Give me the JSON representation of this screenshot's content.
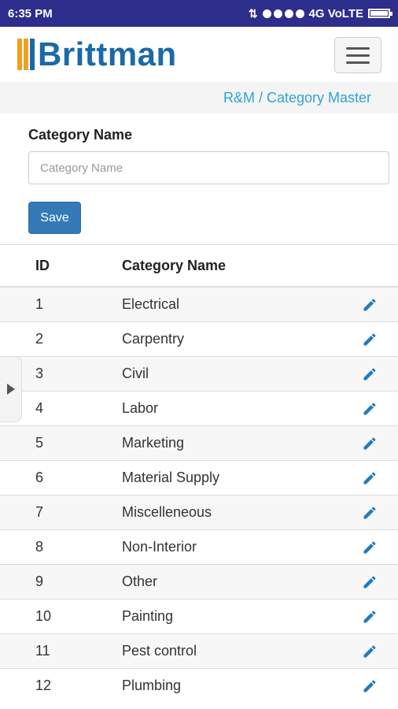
{
  "status_bar": {
    "time": "6:35 PM",
    "network": "4G VoLTE"
  },
  "header": {
    "logo_text": "Brittman"
  },
  "breadcrumb": {
    "text": "R&M / Category Master"
  },
  "form": {
    "label": "Category Name",
    "input_value": "",
    "input_placeholder": "Category Name",
    "save_label": "Save"
  },
  "table": {
    "headers": {
      "id": "ID",
      "name": "Category Name"
    },
    "rows": [
      {
        "id": "1",
        "name": "Electrical"
      },
      {
        "id": "2",
        "name": "Carpentry"
      },
      {
        "id": "3",
        "name": "Civil"
      },
      {
        "id": "4",
        "name": "Labor"
      },
      {
        "id": "5",
        "name": "Marketing"
      },
      {
        "id": "6",
        "name": "Material Supply"
      },
      {
        "id": "7",
        "name": "Miscelleneous"
      },
      {
        "id": "8",
        "name": "Non-Interior"
      },
      {
        "id": "9",
        "name": "Other"
      },
      {
        "id": "10",
        "name": "Painting"
      },
      {
        "id": "11",
        "name": "Pest control"
      },
      {
        "id": "12",
        "name": "Plumbing"
      }
    ]
  },
  "icons": {
    "edit": "pencil-icon",
    "menu": "hamburger-icon",
    "drawer": "chevron-right-icon"
  },
  "colors": {
    "status_bar": "#2d2d8c",
    "brand_blue": "#1b6aa8",
    "brand_orange": "#f0a020",
    "link": "#2ca4d8",
    "primary_button": "#337ab7",
    "edit_icon": "#1f7bc1"
  }
}
